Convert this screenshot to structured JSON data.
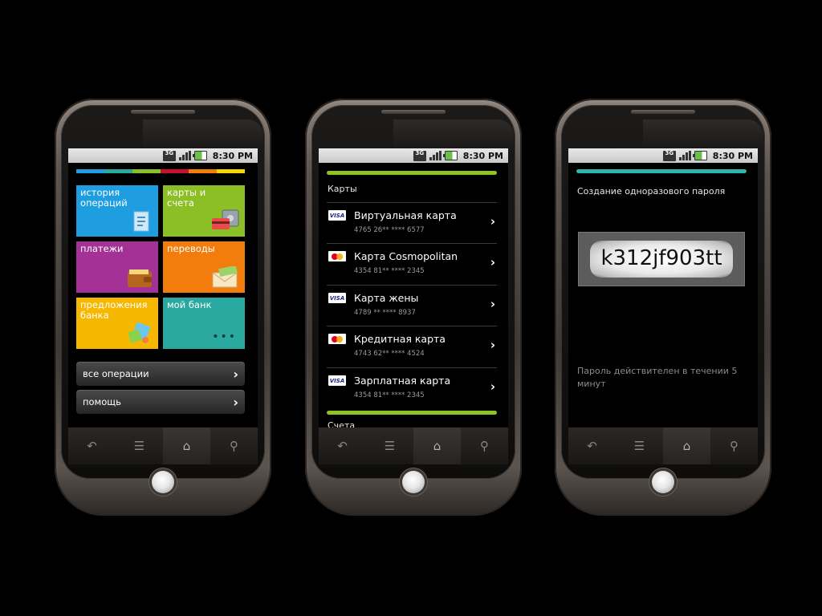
{
  "status": {
    "network": "3G",
    "time": "8:30 PM"
  },
  "screen1": {
    "tiles": [
      {
        "label": "история операций",
        "color": "#1e9ee0"
      },
      {
        "label": "карты и счета",
        "color": "#8cbf26"
      },
      {
        "label": "платежи",
        "color": "#a43195"
      },
      {
        "label": "переводы",
        "color": "#f27d0c"
      },
      {
        "label": "предложения банка",
        "color": "#f5b700"
      },
      {
        "label": "мой банк",
        "color": "#2aa9a0"
      }
    ],
    "rainbow_colors": [
      "#1e9ee0",
      "#2aa9a0",
      "#8cbf26",
      "#c8102e",
      "#f27d0c",
      "#f5d800"
    ],
    "buttons": [
      {
        "label": "все операции"
      },
      {
        "label": "помощь"
      }
    ],
    "more_dots": "•••"
  },
  "screen2": {
    "section_title": "Карты",
    "cards": [
      {
        "name": "Виртуальная карта",
        "number": "4765 26** **** 6577",
        "brand": "visa"
      },
      {
        "name": "Карта Cosmopolitan",
        "number": "4354 81** **** 2345",
        "brand": "mastercard"
      },
      {
        "name": "Карта жены",
        "number": "4789 ** **** 8937",
        "brand": "visa"
      },
      {
        "name": "Кредитная карта",
        "number": "4743 62** **** 4524",
        "brand": "mastercard"
      },
      {
        "name": "Зарплатная карта",
        "number": "4354 81** **** 2345",
        "brand": "visa"
      }
    ],
    "next_section_title": "Счета",
    "visa_label": "VISA",
    "accent_color": "#8fc31f"
  },
  "screen3": {
    "title": "Создание одноразового пароля",
    "password": "k312jf903tt",
    "validity_note": "Пароль действителен в течении 5 минут",
    "accent_color": "#2cb4ad"
  },
  "navbar": {
    "icons": [
      "back-icon",
      "menu-icon",
      "home-icon",
      "search-icon"
    ]
  }
}
